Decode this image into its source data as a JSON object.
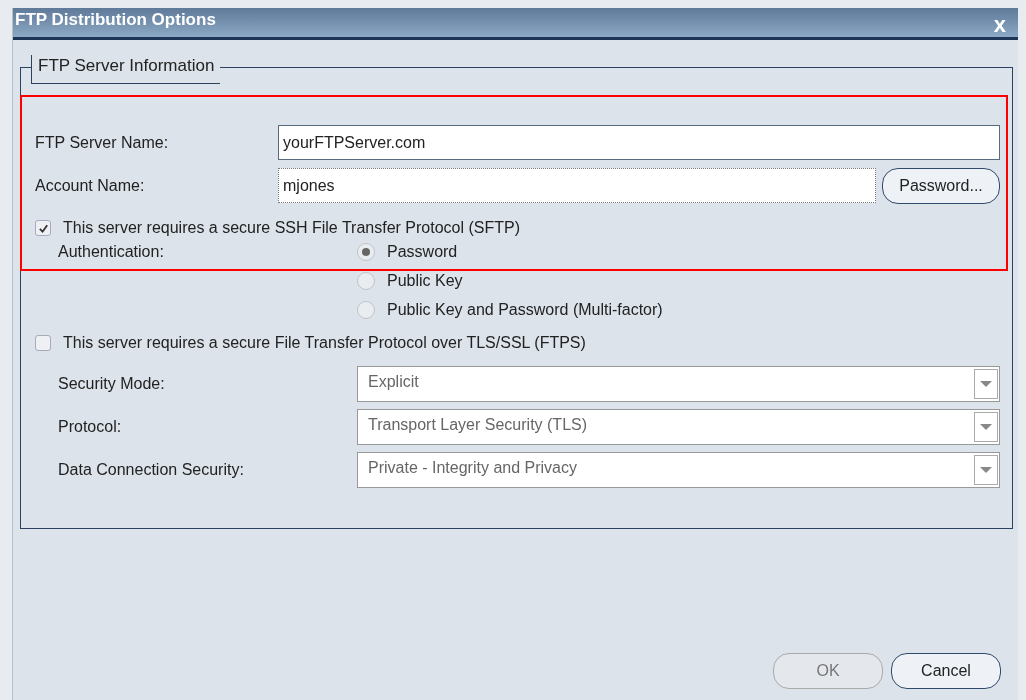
{
  "window": {
    "title": "FTP Distribution Options",
    "close": "x"
  },
  "server_info": {
    "legend": "FTP Server Information",
    "fields": [
      {
        "label": "FTP Server Name:",
        "value": "yourFTPServer.com"
      },
      {
        "label": "Account Name:",
        "value": "mjones"
      }
    ],
    "password_button": "Password...",
    "sftp": {
      "label": "This server requires a secure SSH File Transfer Protocol (SFTP)",
      "checked": true
    },
    "authentication": {
      "label": "Authentication:",
      "options": [
        {
          "label": "Password",
          "selected": true
        },
        {
          "label": "Public Key",
          "selected": false
        },
        {
          "label": "Public Key and Password (Multi-factor)",
          "selected": false
        }
      ]
    },
    "ftps": {
      "label": "This server requires a secure File Transfer Protocol over TLS/SSL (FTPS)",
      "checked": false
    },
    "selects": [
      {
        "label": "Security Mode:",
        "value": "Explicit",
        "disabled": true
      },
      {
        "label": "Protocol:",
        "value": "Transport Layer Security (TLS)",
        "disabled": true
      },
      {
        "label": "Data Connection Security:",
        "value": "Private - Integrity and Privacy",
        "disabled": true
      }
    ]
  },
  "buttons": [
    {
      "label": "OK",
      "disabled": true
    },
    {
      "label": "Cancel",
      "disabled": false
    }
  ]
}
